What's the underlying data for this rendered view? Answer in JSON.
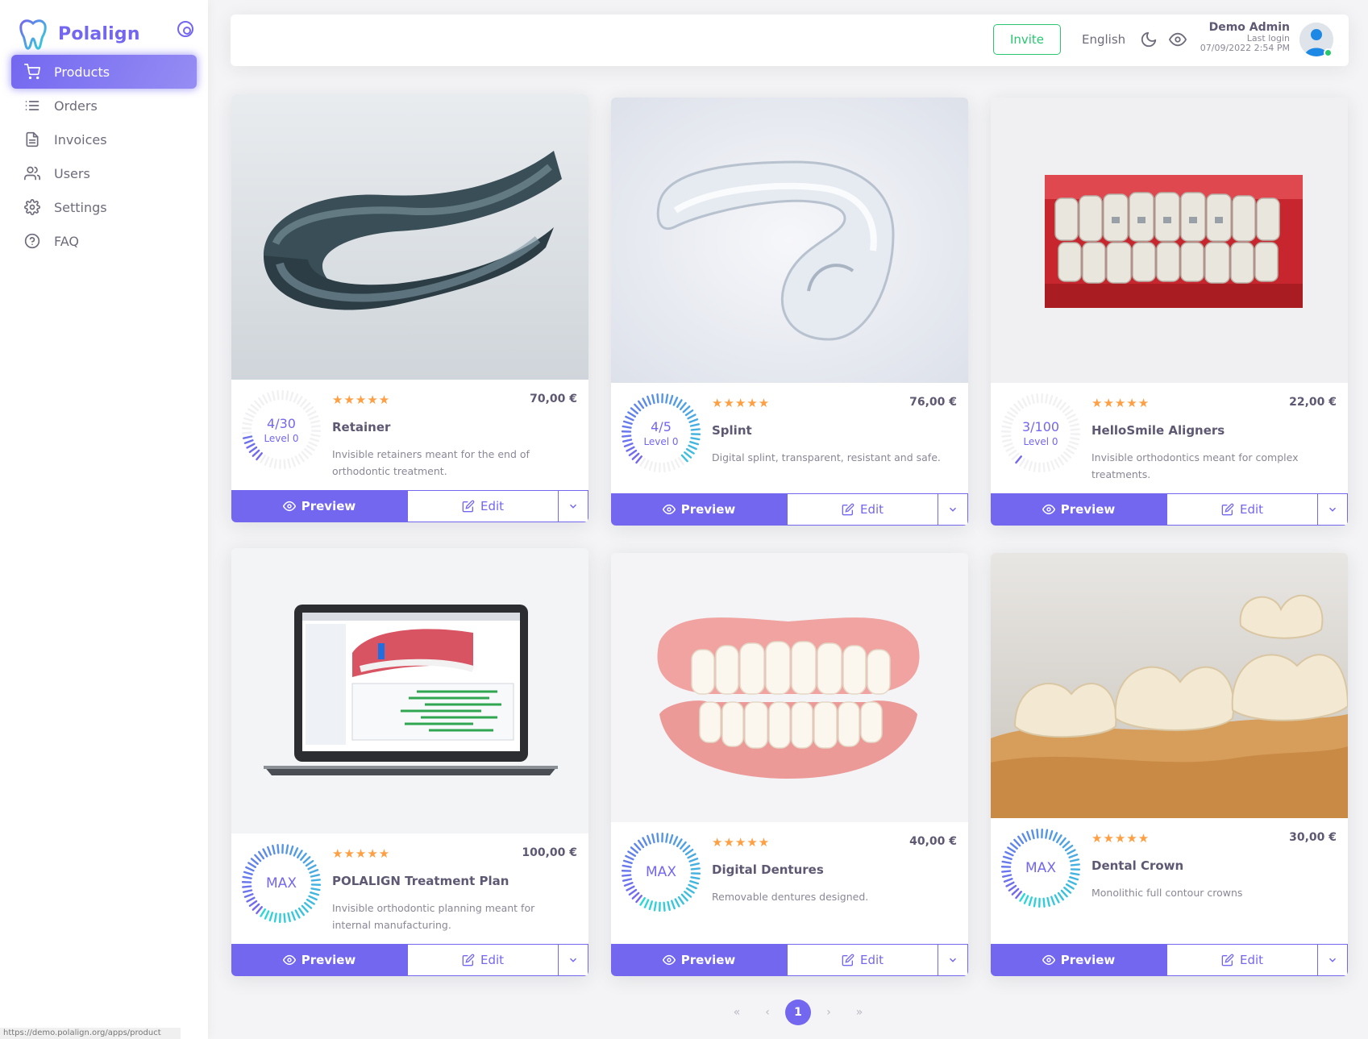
{
  "brand": {
    "name": "Polalign"
  },
  "nav": [
    {
      "label": "Products",
      "icon": "cart-icon",
      "active": true
    },
    {
      "label": "Orders",
      "icon": "list-icon",
      "active": false
    },
    {
      "label": "Invoices",
      "icon": "file-icon",
      "active": false
    },
    {
      "label": "Users",
      "icon": "users-icon",
      "active": false
    },
    {
      "label": "Settings",
      "icon": "gear-icon",
      "active": false
    },
    {
      "label": "FAQ",
      "icon": "help-circle-icon",
      "active": false
    }
  ],
  "topbar": {
    "invite_label": "Invite",
    "language": "English",
    "user_name": "Demo Admin",
    "last_login_label": "Last login",
    "last_login_value": "07/09/2022 2:54 PM"
  },
  "products": [
    {
      "name": "Retainer",
      "price": "70,00 €",
      "rating": 5,
      "gauge_value": "4/30",
      "gauge_level": "Level 0",
      "progress": 0.133,
      "max": false,
      "description": "Invisible retainers meant for the end of orthodontic treatment.",
      "image": "retainer-image",
      "preview_label": "Preview",
      "edit_label": "Edit"
    },
    {
      "name": "Splint",
      "price": "76,00 €",
      "rating": 5,
      "gauge_value": "4/5",
      "gauge_level": "Level 0",
      "progress": 0.8,
      "max": false,
      "description": "Digital splint, transparent, resistant and safe.",
      "image": "splint-image",
      "preview_label": "Preview",
      "edit_label": "Edit"
    },
    {
      "name": "HelloSmile Aligners",
      "price": "22,00 €",
      "rating": 5,
      "gauge_value": "3/100",
      "gauge_level": "Level 0",
      "progress": 0.03,
      "max": false,
      "description": "Invisible orthodontics meant for complex treatments.",
      "image": "aligners-image",
      "preview_label": "Preview",
      "edit_label": "Edit"
    },
    {
      "name": "POLALIGN Treatment Plan",
      "price": "100,00 €",
      "rating": 5,
      "gauge_value": "MAX",
      "gauge_level": "",
      "progress": 1.0,
      "max": true,
      "description": "Invisible orthodontic planning meant for internal manufacturing.",
      "image": "treatment-plan-image",
      "preview_label": "Preview",
      "edit_label": "Edit"
    },
    {
      "name": "Digital Dentures",
      "price": "40,00 €",
      "rating": 5,
      "gauge_value": "MAX",
      "gauge_level": "",
      "progress": 1.0,
      "max": true,
      "description": "Removable dentures designed.",
      "image": "dentures-image",
      "preview_label": "Preview",
      "edit_label": "Edit"
    },
    {
      "name": "Dental Crown",
      "price": "30,00 €",
      "rating": 5,
      "gauge_value": "MAX",
      "gauge_level": "",
      "progress": 1.0,
      "max": true,
      "description": "Monolithic full contour crowns",
      "image": "crown-image",
      "preview_label": "Preview",
      "edit_label": "Edit"
    }
  ],
  "pagination": {
    "first": "«",
    "prev": "‹",
    "current": "1",
    "next": "›",
    "last": "»"
  },
  "status_url": "https://demo.polalign.org/apps/product",
  "colors": {
    "accent": "#7367f0",
    "success": "#28c76f",
    "star": "#ff9f43",
    "gauge_start": "#7367f0",
    "gauge_end": "#2bd8d8"
  }
}
